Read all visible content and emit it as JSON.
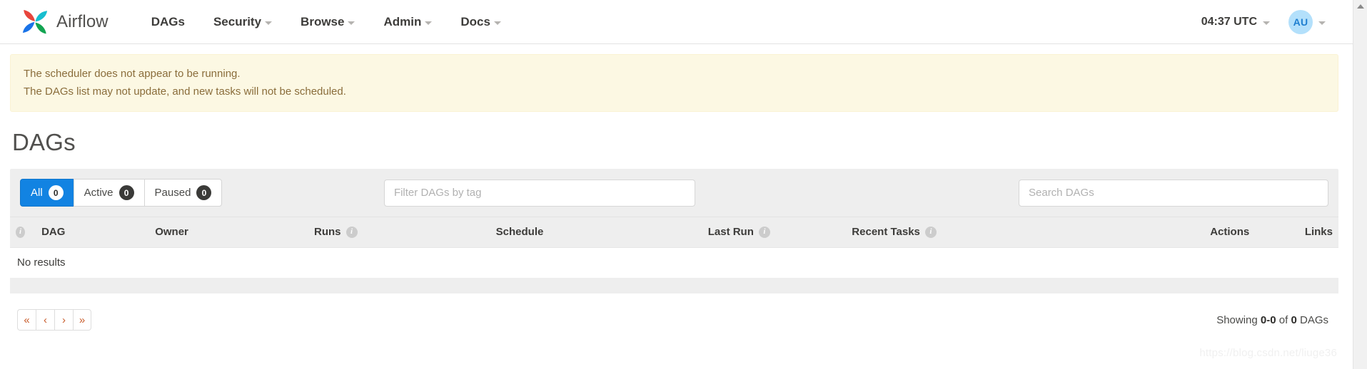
{
  "navbar": {
    "brand": "Airflow",
    "brand_logo_icon": "airflow-pinwheel-logo",
    "items": [
      {
        "label": "DAGs",
        "has_caret": false
      },
      {
        "label": "Security",
        "has_caret": true
      },
      {
        "label": "Browse",
        "has_caret": true
      },
      {
        "label": "Admin",
        "has_caret": true
      },
      {
        "label": "Docs",
        "has_caret": true
      }
    ],
    "clock": "04:37 UTC",
    "avatar_initials": "AU"
  },
  "alert": {
    "line1": "The scheduler does not appear to be running.",
    "line2": "The DAGs list may not update, and new tasks will not be scheduled."
  },
  "page": {
    "title": "DAGs"
  },
  "filters": {
    "tabs": [
      {
        "label": "All",
        "count": "0",
        "active": true
      },
      {
        "label": "Active",
        "count": "0",
        "active": false
      },
      {
        "label": "Paused",
        "count": "0",
        "active": false
      }
    ],
    "tag_filter_placeholder": "Filter DAGs by tag",
    "tag_filter_value": "",
    "search_placeholder": "Search DAGs",
    "search_value": ""
  },
  "table": {
    "columns": [
      {
        "label": "",
        "info": true,
        "align": "left"
      },
      {
        "label": "DAG",
        "info": false,
        "align": "left"
      },
      {
        "label": "Owner",
        "info": false,
        "align": "left"
      },
      {
        "label": "Runs",
        "info": true,
        "align": "left"
      },
      {
        "label": "Schedule",
        "info": false,
        "align": "left"
      },
      {
        "label": "Last Run",
        "info": true,
        "align": "left"
      },
      {
        "label": "Recent Tasks",
        "info": true,
        "align": "left"
      },
      {
        "label": "Actions",
        "info": false,
        "align": "right"
      },
      {
        "label": "Links",
        "info": false,
        "align": "right"
      }
    ],
    "empty_message": "No results",
    "rows": []
  },
  "pagination": {
    "buttons": [
      {
        "icon": "first-page-icon",
        "glyph": "«"
      },
      {
        "icon": "previous-page-icon",
        "glyph": "‹"
      },
      {
        "icon": "next-page-icon",
        "glyph": "›"
      },
      {
        "icon": "last-page-icon",
        "glyph": "»"
      }
    ],
    "showing_prefix": "Showing ",
    "showing_range": "0-0",
    "showing_middle": " of ",
    "showing_total": "0",
    "showing_suffix": " DAGs"
  },
  "watermark": "https://blog.csdn.net/liuge36",
  "colors": {
    "accent_blue": "#1283e2",
    "alert_bg": "#fcf8e3",
    "alert_text": "#8a6d3b",
    "panel_grey": "#eeeeee",
    "avatar_bg": "#b3e0fb",
    "pager_link": "#c85b2a"
  }
}
